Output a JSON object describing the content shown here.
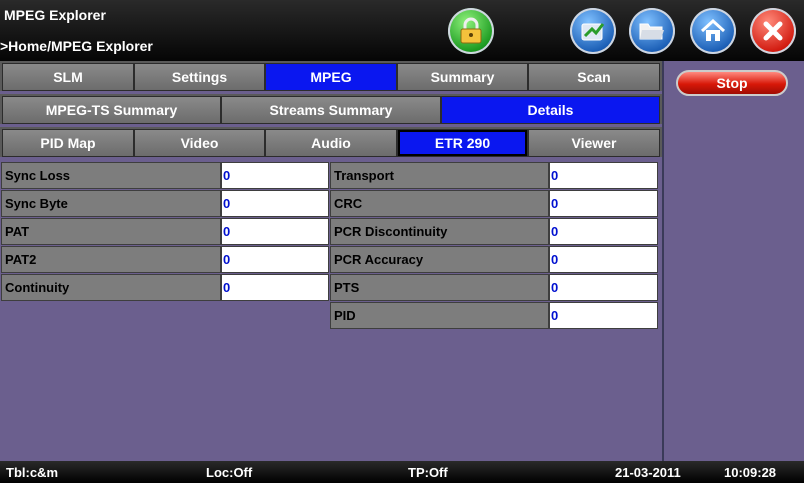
{
  "header": {
    "title": "MPEG Explorer",
    "breadcrumb": ">Home/MPEG Explorer",
    "icons": [
      "lock-icon",
      "tool-icon",
      "folder-icon",
      "home-icon",
      "close-icon"
    ]
  },
  "tabs_row1": [
    "SLM",
    "Settings",
    "MPEG",
    "Summary",
    "Scan"
  ],
  "tabs_row2": [
    "MPEG-TS Summary",
    "Streams Summary",
    "Details"
  ],
  "tabs_row3": [
    "PID Map",
    "Video",
    "Audio",
    "ETR 290",
    "Viewer"
  ],
  "left_table": [
    {
      "label": "Sync Loss",
      "value": "0"
    },
    {
      "label": "Sync Byte",
      "value": "0"
    },
    {
      "label": "PAT",
      "value": "0"
    },
    {
      "label": "PAT2",
      "value": "0"
    },
    {
      "label": "Continuity",
      "value": "0"
    }
  ],
  "right_table": [
    {
      "label": "Transport",
      "value": "0"
    },
    {
      "label": "CRC",
      "value": "0"
    },
    {
      "label": "PCR Discontinuity",
      "value": "0"
    },
    {
      "label": "PCR Accuracy",
      "value": "0"
    },
    {
      "label": "PTS",
      "value": "0"
    },
    {
      "label": "PID",
      "value": "0"
    }
  ],
  "side": {
    "stop_label": "Stop"
  },
  "status": {
    "tbl": "Tbl:c&m",
    "loc": "Loc:Off",
    "tp": "TP:Off",
    "date": "21-03-2011",
    "time": "10:09:28"
  },
  "colors": {
    "active_tab": "#0a17f0",
    "background": "#6b5f8e",
    "value_text": "#0010d0"
  }
}
